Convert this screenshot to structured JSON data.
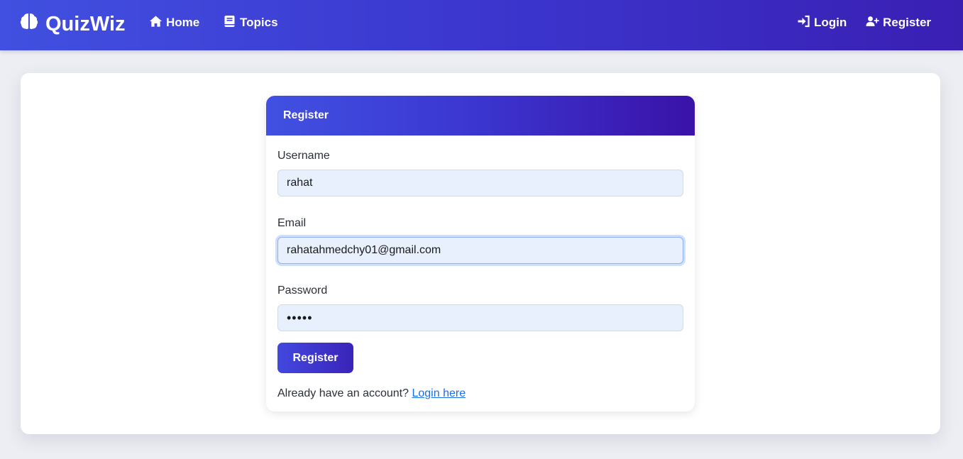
{
  "navbar": {
    "brand": "QuizWiz",
    "brand_icon": "brain-icon",
    "links": {
      "home": "Home",
      "topics": "Topics",
      "login": "Login",
      "register": "Register"
    }
  },
  "form": {
    "title": "Register",
    "username": {
      "label": "Username",
      "value": "rahat"
    },
    "email": {
      "label": "Email",
      "value": "rahatahmedchy01@gmail.com"
    },
    "password": {
      "label": "Password",
      "value": "•••••"
    },
    "submit_label": "Register",
    "login_prompt": "Already have an account?",
    "login_link": "Login here"
  },
  "colors": {
    "accent": "#3b34cc",
    "input_bg": "#e8f0fe",
    "link": "#1a6ee6"
  }
}
